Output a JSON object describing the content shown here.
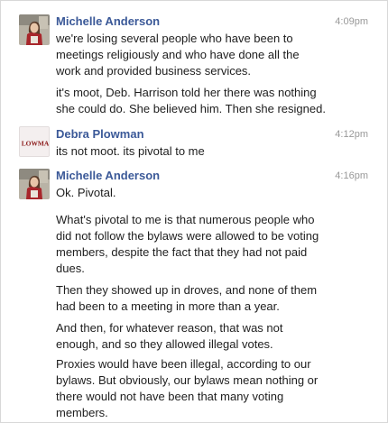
{
  "messages": [
    {
      "sender": "Michelle Anderson",
      "time": "4:09pm",
      "avatar": "photo-avatar",
      "paragraphs": [
        "we're losing several people who have been to\nmeetings religiously and who have done all the\nwork and provided business services.",
        "it's moot, Deb. Harrison told her there was nothing\nshe could do. She believed him. Then she resigned."
      ]
    },
    {
      "sender": "Debra Plowman",
      "time": "4:12pm",
      "avatar": "logo-avatar",
      "avatar_text": "LOWMA",
      "paragraphs": [
        "its not moot. its pivotal to me"
      ]
    },
    {
      "sender": "Michelle Anderson",
      "time": "4:16pm",
      "avatar": "photo-avatar",
      "paragraphs": [
        "Ok. Pivotal.",
        "What's pivotal to me is that numerous people who\ndid not follow the bylaws were allowed to be voting\nmembers, despite the fact that they had not paid\ndues.",
        "Then they showed up in droves, and none of them\nhad been to a meeting in more than a year.",
        "And then, for whatever reason, that was not\nenough, and so they allowed illegal votes.",
        "Proxies would have been illegal, according to our\nbylaws. But obviously, our bylaws mean nothing or\nthere would not have been that many voting\nmembers."
      ]
    }
  ],
  "colors": {
    "sender_link": "#3b5998",
    "timestamp": "#999999",
    "body_text": "#1e1e1e",
    "logo_text": "#8b1a1a"
  }
}
